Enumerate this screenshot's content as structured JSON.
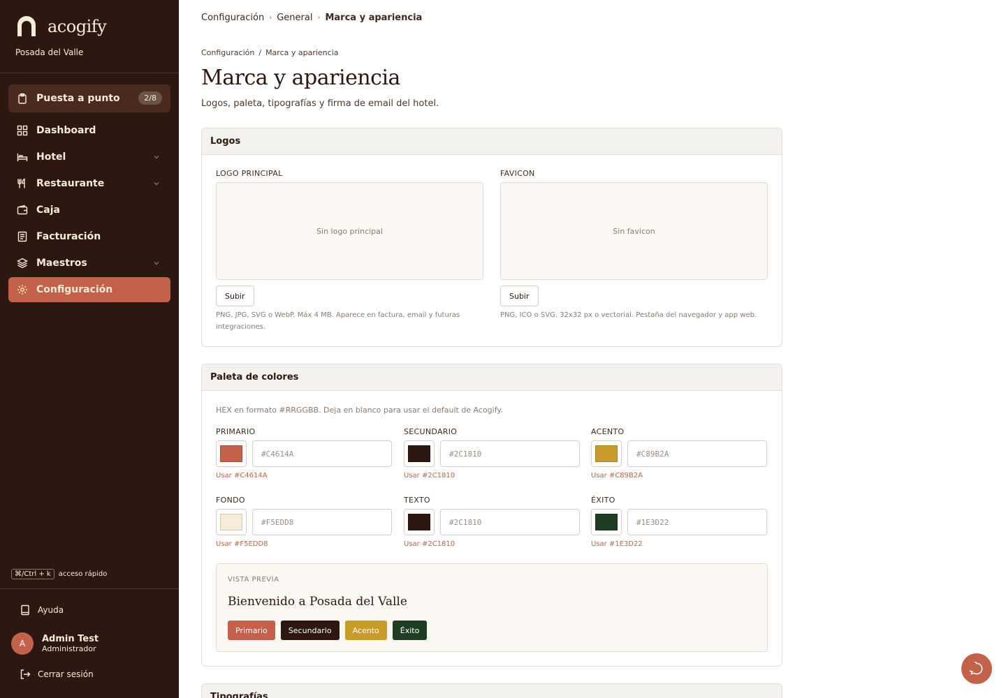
{
  "brand": {
    "name": "acogify",
    "hotel": "Posada del Valle"
  },
  "sidebar": {
    "setup": {
      "label": "Puesta a punto",
      "badge": "2/8"
    },
    "items": [
      {
        "label": "Dashboard"
      },
      {
        "label": "Hotel"
      },
      {
        "label": "Restaurante"
      },
      {
        "label": "Caja"
      },
      {
        "label": "Facturación"
      },
      {
        "label": "Maestros"
      },
      {
        "label": "Configuración"
      }
    ],
    "shortcut": {
      "keys": "⌘/Ctrl + k",
      "label": "acceso rápido"
    },
    "help": "Ayuda",
    "user": {
      "initial": "A",
      "name": "Admin Test",
      "role": "Administrador"
    },
    "logout": "Cerrar sesión"
  },
  "breadcrumb_top": [
    "Configuración",
    "General",
    "Marca y apariencia"
  ],
  "breadcrumb_sub": [
    "Configuración",
    "/",
    "Marca y apariencia"
  ],
  "page": {
    "title": "Marca y apariencia",
    "subtitle": "Logos, paleta, tipografías y firma de email del hotel."
  },
  "logos": {
    "title": "Logos",
    "main": {
      "label": "LOGO PRINCIPAL",
      "empty": "Sin logo principal",
      "button": "Subir",
      "hint": "PNG, JPG, SVG o WebP. Máx 4 MB. Aparece en factura, email y futuras integraciones."
    },
    "favicon": {
      "label": "FAVICON",
      "empty": "Sin favicon",
      "button": "Subir",
      "hint": "PNG, ICO o SVG. 32x32 px o vectorial. Pestaña del navegador y app web."
    }
  },
  "palette": {
    "title": "Paleta de colores",
    "hint": "HEX en formato #RRGGBB. Deja en blanco para usar el default de Acogify.",
    "colors": [
      {
        "label": "PRIMARIO",
        "placeholder": "#C4614A",
        "use": "Usar #C4614A",
        "hex": "#c4614a"
      },
      {
        "label": "SECUNDARIO",
        "placeholder": "#2C1810",
        "use": "Usar #2C1810",
        "hex": "#2c1810"
      },
      {
        "label": "ACENTO",
        "placeholder": "#C89B2A",
        "use": "Usar #C89B2A",
        "hex": "#c89b2a"
      },
      {
        "label": "FONDO",
        "placeholder": "#F5EDD8",
        "use": "Usar #F5EDD8",
        "hex": "#f5edd8"
      },
      {
        "label": "TEXTO",
        "placeholder": "#2C1810",
        "use": "Usar #2C1810",
        "hex": "#2c1810"
      },
      {
        "label": "ÉXITO",
        "placeholder": "#1E3D22",
        "use": "Usar #1E3D22",
        "hex": "#1e3d22"
      }
    ],
    "preview": {
      "label": "VISTA PREVIA",
      "title": "Bienvenido a Posada del Valle",
      "chips": [
        "Primario",
        "Secundario",
        "Acento",
        "Éxito"
      ]
    }
  },
  "typography": {
    "title": "Tipografías"
  }
}
